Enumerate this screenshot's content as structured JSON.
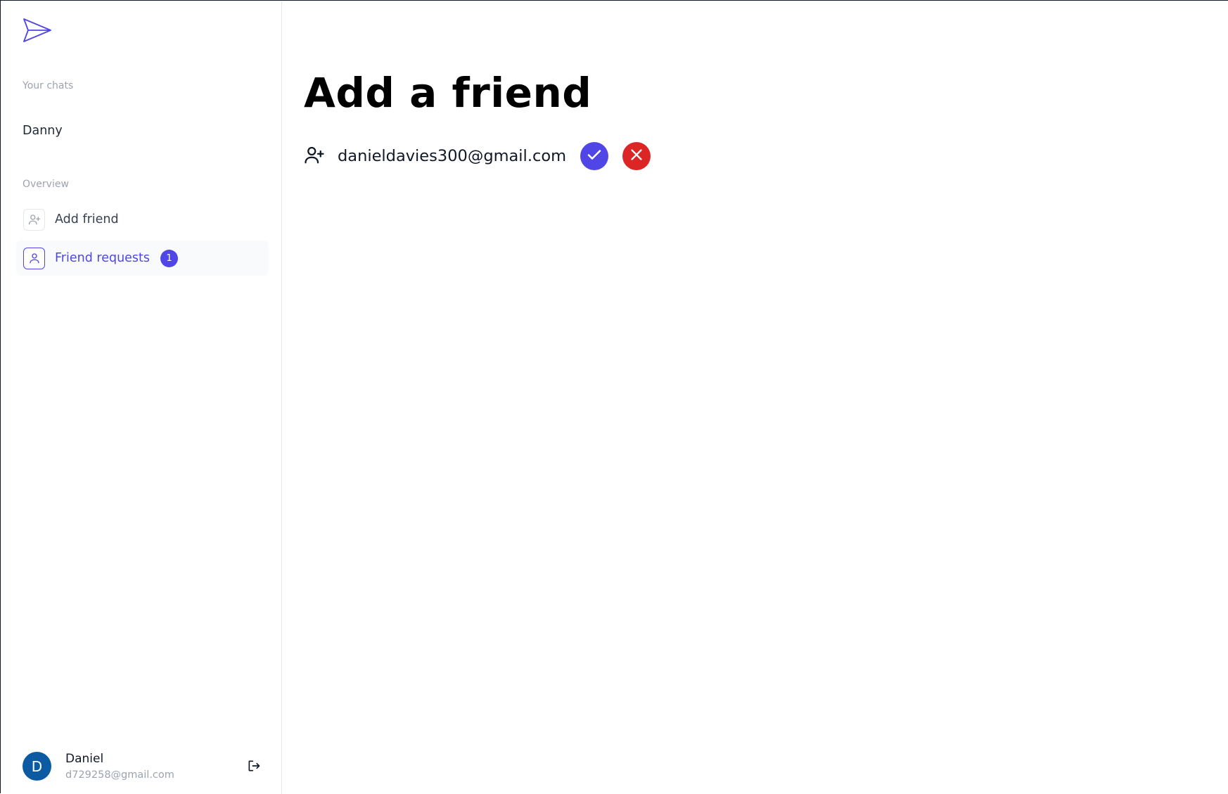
{
  "sidebar": {
    "logo_icon": "paper-plane-icon",
    "chats_label": "Your chats",
    "chats": [
      {
        "name": "Danny"
      }
    ],
    "overview_label": "Overview",
    "items": [
      {
        "label": "Add friend",
        "icon": "user-plus-icon",
        "active": false
      },
      {
        "label": "Friend requests",
        "icon": "user-icon",
        "active": true,
        "badge": "1"
      }
    ],
    "profile": {
      "initial": "D",
      "name": "Daniel",
      "email": "d729258@gmail.com",
      "signout_icon": "sign-out-icon"
    }
  },
  "main": {
    "title": "Add a friend",
    "requests": [
      {
        "email": "danieldavies300@gmail.com"
      }
    ]
  },
  "colors": {
    "accent": "#4f46e5",
    "danger": "#dc2626",
    "avatar": "#0b5aa2",
    "muted_text": "#9ca3af"
  }
}
